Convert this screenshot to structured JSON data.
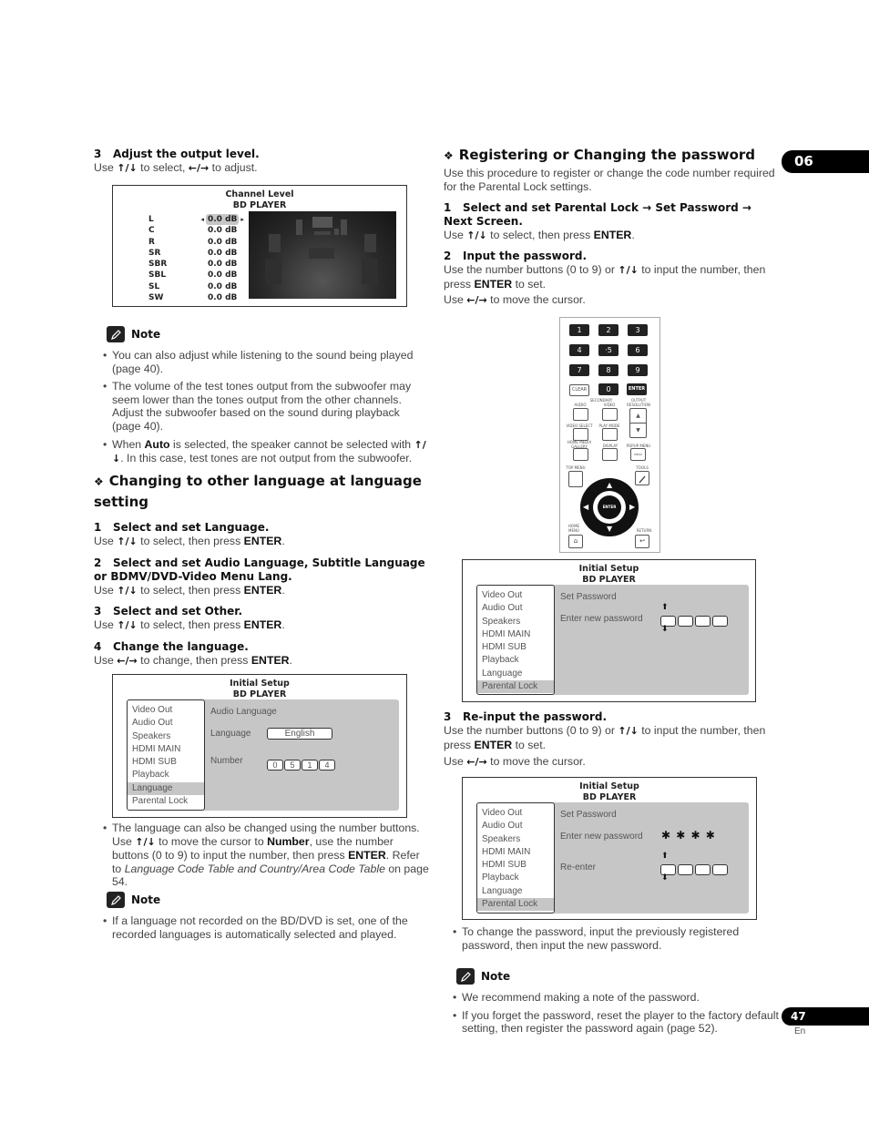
{
  "chapter_tab": "06",
  "page_number": "47",
  "page_lang": "En",
  "left": {
    "step3": {
      "num": "3",
      "heading": "Adjust the output level.",
      "text_parts": [
        "Use ",
        "↑/↓",
        " to select, ",
        "←/→",
        " to adjust."
      ]
    },
    "channel_screen": {
      "title": "Channel Level",
      "subtitle": "BD PLAYER",
      "channels": [
        {
          "name": "L",
          "value": "0.0 dB",
          "selected": true
        },
        {
          "name": "C",
          "value": "0.0 dB"
        },
        {
          "name": "R",
          "value": "0.0 dB"
        },
        {
          "name": "SR",
          "value": "0.0 dB"
        },
        {
          "name": "SBR",
          "value": "0.0 dB"
        },
        {
          "name": "SBL",
          "value": "0.0 dB"
        },
        {
          "name": "SL",
          "value": "0.0 dB"
        },
        {
          "name": "SW",
          "value": "0.0 dB"
        }
      ],
      "left_arrow": "◂",
      "right_arrow": "▸"
    },
    "note1": {
      "label": "Note",
      "items": [
        "You can also adjust while listening to the sound being played (page 40).",
        "The volume of the test tones output from the subwoofer may seem lower than the tones output from the other channels. Adjust the subwoofer based on the sound during playback (page 40).",
        {
          "pre": "When ",
          "bold": "Auto",
          "post": " is selected, the speaker cannot be selected with ",
          "arrows": "↑/↓",
          "tail": ". In this case, test tones are not output from the subwoofer."
        }
      ]
    },
    "section_language": {
      "title": "Changing to other language at language setting",
      "steps": [
        {
          "num": "1",
          "heading": "Select and set Language.",
          "pre": "Use ",
          "arrows": "↑/↓",
          "mid": " to select, then press ",
          "bold": "ENTER",
          "post": "."
        },
        {
          "num": "2",
          "heading": "Select and set Audio Language, Subtitle Language or BDMV/DVD-Video Menu Lang.",
          "pre": "Use ",
          "arrows": "↑/↓",
          "mid": " to select, then press ",
          "bold": "ENTER",
          "post": "."
        },
        {
          "num": "3",
          "heading": "Select and set Other.",
          "pre": "Use ",
          "arrows": "↑/↓",
          "mid": " to select, then press ",
          "bold": "ENTER",
          "post": "."
        },
        {
          "num": "4",
          "heading": "Change the language.",
          "pre": "Use ",
          "arrows": "←/→",
          "mid": " to change, then press ",
          "bold": "ENTER",
          "post": "."
        }
      ]
    },
    "language_screen": {
      "title": "Initial Setup",
      "subtitle": "BD PLAYER",
      "menu": [
        "Video Out",
        "Audio Out",
        "Speakers",
        "HDMI MAIN",
        "HDMI SUB",
        "Playback",
        "Language",
        "Parental Lock"
      ],
      "selected_index": 6,
      "panel_heading": "Audio Language",
      "language_label": "Language",
      "language_value": "English",
      "number_label": "Number",
      "number_digits": [
        "0",
        "5",
        "1",
        "4"
      ]
    },
    "lang_bullet": {
      "p1": "The language can also be changed using the number buttons. Use ",
      "arrows": "↑/↓",
      "p2": " to move the cursor to ",
      "b1": "Number",
      "p3": ", use the number buttons (0 to 9) to input the number, then press ",
      "b2": "ENTER",
      "p4": ". Refer to ",
      "italic": "Language Code Table and Country/Area Code Table",
      "p5": " on page 54."
    },
    "note2": {
      "label": "Note",
      "items": [
        "If a language not recorded on the BD/DVD is set, one of the recorded languages is automatically selected and played."
      ]
    }
  },
  "right": {
    "section_password": {
      "title": "Registering or Changing the password",
      "intro": "Use this procedure to register or change the code number required for the Parental Lock settings."
    },
    "step1": {
      "num": "1",
      "heading": "Select and set Parental Lock → Set Password → Next Screen.",
      "pre": "Use ",
      "arrows": "↑/↓",
      "mid": " to select, then press ",
      "bold": "ENTER",
      "post": "."
    },
    "step2": {
      "num": "2",
      "heading": "Input the password.",
      "l1_pre": "Use the number buttons (0 to 9) or ",
      "arrows": "↑/↓",
      "l1_post": " to input the number, then press ",
      "bold": "ENTER",
      "l1_end": " to set.",
      "l2_pre": "Use ",
      "l2_arrows": "←/→",
      "l2_post": " to move the cursor."
    },
    "remote": {
      "numbers": [
        "1",
        "2",
        "3",
        "4",
        "·5",
        "6",
        "7",
        "8",
        "9"
      ],
      "clear": "CLEAR",
      "zero": "0",
      "enter": "ENTER",
      "secondary": "SECONDARY",
      "audio": "AUDIO",
      "video": "VIDEO",
      "output_resolution": "OUTPUT RESOLUTION",
      "video_select": "VIDEO SELECT",
      "play_mode": "PLAY MODE",
      "home_media_gallery": "HOME MEDIA GALLERY",
      "display": "DISPLAY",
      "popup_menu": "POPUP MENU",
      "menu": "MENU",
      "top_menu": "TOP MENU",
      "tools": "TOOLS",
      "home_menu": "HOME MENU",
      "return": "RETURN",
      "up": "▲",
      "down": "▼"
    },
    "password_screen1": {
      "title": "Initial Setup",
      "subtitle": "BD PLAYER",
      "menu": [
        "Video Out",
        "Audio Out",
        "Speakers",
        "HDMI MAIN",
        "HDMI SUB",
        "Playback",
        "Language",
        "Parental Lock"
      ],
      "selected_index": 7,
      "panel_heading": "Set Password",
      "enter_label": "Enter new password"
    },
    "step3": {
      "num": "3",
      "heading": "Re-input the password.",
      "l1_pre": "Use the number buttons (0 to 9) or ",
      "arrows": "↑/↓",
      "l1_post": " to input the number, then press ",
      "bold": "ENTER",
      "l1_end": " to set.",
      "l2_pre": "Use ",
      "l2_arrows": "←/→",
      "l2_post": " to move the cursor."
    },
    "password_screen2": {
      "title": "Initial Setup",
      "subtitle": "BD PLAYER",
      "menu": [
        "Video Out",
        "Audio Out",
        "Speakers",
        "HDMI MAIN",
        "HDMI SUB",
        "Playback",
        "Language",
        "Parental Lock"
      ],
      "selected_index": 7,
      "panel_heading": "Set Password",
      "enter_label": "Enter new password",
      "masked": "✱ ✱ ✱ ✱",
      "reenter_label": "Re-enter"
    },
    "change_bullet": "To change the password, input the previously registered password, then input the new password.",
    "note3": {
      "label": "Note",
      "items": [
        "We recommend making a note of the password.",
        "If you forget the password, reset the player to the factory default setting, then register the password again (page 52)."
      ]
    }
  }
}
